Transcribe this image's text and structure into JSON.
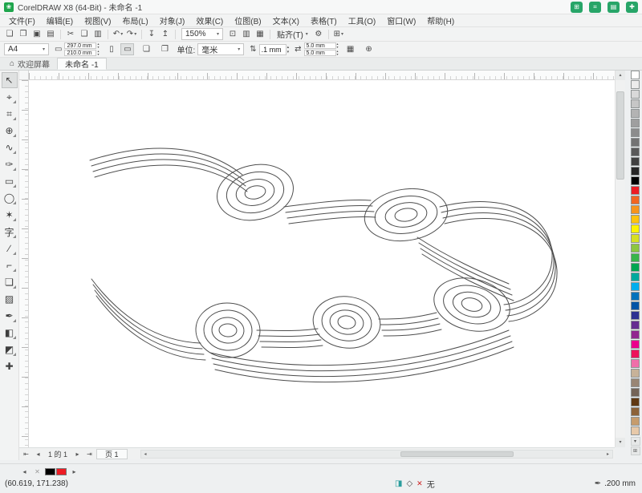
{
  "window": {
    "title": "CorelDRAW X8 (64-Bit) - 未命名 -1",
    "actions": [
      {
        "name": "action-1",
        "glyph": "⊞"
      },
      {
        "name": "action-2",
        "glyph": "⌗"
      },
      {
        "name": "action-3",
        "glyph": "▤"
      },
      {
        "name": "action-4",
        "glyph": "✚"
      }
    ]
  },
  "menu": {
    "items": [
      {
        "name": "file",
        "label": "文件(F)"
      },
      {
        "name": "edit",
        "label": "编辑(E)"
      },
      {
        "name": "view",
        "label": "视图(V)"
      },
      {
        "name": "layout",
        "label": "布局(L)"
      },
      {
        "name": "object",
        "label": "对象(J)"
      },
      {
        "name": "effects",
        "label": "效果(C)"
      },
      {
        "name": "bitmaps",
        "label": "位图(B)"
      },
      {
        "name": "text",
        "label": "文本(X)"
      },
      {
        "name": "table",
        "label": "表格(T)"
      },
      {
        "name": "tools",
        "label": "工具(O)"
      },
      {
        "name": "window",
        "label": "窗口(W)"
      },
      {
        "name": "help",
        "label": "帮助(H)"
      }
    ]
  },
  "toolbar": {
    "left": [
      {
        "name": "new-document",
        "glyph": "❏"
      },
      {
        "name": "open",
        "glyph": "❐"
      },
      {
        "name": "save",
        "glyph": "▣"
      },
      {
        "name": "print",
        "glyph": "▤"
      },
      {
        "sep": true
      },
      {
        "name": "cut",
        "glyph": "✂"
      },
      {
        "name": "copy",
        "glyph": "❑"
      },
      {
        "name": "paste",
        "glyph": "▥"
      },
      {
        "sep": true
      },
      {
        "name": "undo",
        "glyph": "↶",
        "dd": true
      },
      {
        "name": "redo",
        "glyph": "↷",
        "dd": true
      },
      {
        "sep": true
      },
      {
        "name": "import",
        "glyph": "↧"
      },
      {
        "name": "export",
        "glyph": "↥"
      },
      {
        "sep": true
      }
    ],
    "zoom_value": "150%",
    "mid": [
      {
        "name": "full-screen-preview",
        "glyph": "⊡"
      },
      {
        "name": "show-rulers",
        "glyph": "▥"
      },
      {
        "name": "show-grid",
        "glyph": "▦"
      },
      {
        "sep": true
      }
    ],
    "snap_label": "贴齐(T)",
    "end": [
      {
        "name": "options",
        "glyph": "⚙"
      },
      {
        "sep": true
      },
      {
        "name": "application-launcher",
        "glyph": "⊞",
        "dd": true
      }
    ]
  },
  "property_bar": {
    "page_size": "A4",
    "dims_icon": "▭",
    "width_value": "297.0 mm",
    "height_value": "210.0 mm",
    "portrait_glyph": "▯",
    "landscape_glyph": "▭",
    "pages": [
      {
        "name": "current-page-size",
        "glyph": "❏"
      },
      {
        "name": "all-pages-size",
        "glyph": "❐"
      }
    ],
    "units_label": "单位:",
    "units_value": "毫米",
    "nudge_icon": "⇅",
    "nudge_value": ".1 mm",
    "dup_icon": "⇄",
    "dup_x": "5.0 mm",
    "dup_y": "5.0 mm",
    "trailing": [
      {
        "name": "grid-toggle",
        "glyph": "▦"
      },
      {
        "name": "more-options",
        "glyph": "⊕"
      }
    ]
  },
  "tabs": {
    "welcome": "欢迎屏幕",
    "doc": "未命名 -1"
  },
  "toolbox": {
    "tools": [
      {
        "name": "pick",
        "glyph": "↖",
        "selected": true
      },
      {
        "name": "shape",
        "glyph": "⌖",
        "flyout": true
      },
      {
        "name": "crop",
        "glyph": "⌗",
        "flyout": true
      },
      {
        "name": "zoom",
        "glyph": "⊕",
        "flyout": true
      },
      {
        "name": "freehand",
        "glyph": "∿",
        "flyout": true
      },
      {
        "name": "artistic-media",
        "glyph": "✑",
        "flyout": true
      },
      {
        "name": "rectangle",
        "glyph": "▭",
        "flyout": true
      },
      {
        "name": "ellipse",
        "glyph": "◯",
        "flyout": true
      },
      {
        "name": "polygon",
        "glyph": "✶",
        "flyout": true
      },
      {
        "name": "text",
        "glyph": "字",
        "flyout": true
      },
      {
        "name": "parallel-dimension",
        "glyph": "∕",
        "flyout": true
      },
      {
        "name": "connector",
        "glyph": "⌐",
        "flyout": true
      },
      {
        "name": "drop-shadow",
        "glyph": "❏",
        "flyout": true
      },
      {
        "name": "transparency",
        "glyph": "▨"
      },
      {
        "name": "color-eyedropper",
        "glyph": "✒",
        "flyout": true
      },
      {
        "name": "interactive-fill",
        "glyph": "◧",
        "flyout": true
      },
      {
        "name": "smart-fill",
        "glyph": "◩",
        "flyout": true
      },
      {
        "name": "customize-toolbox",
        "glyph": "✚"
      }
    ]
  },
  "palette": {
    "colors": [
      "#FFFFFF",
      "#ECECEC",
      "#D9D9D9",
      "#C6C6C6",
      "#B3B3B3",
      "#9F9F9F",
      "#8C8C8C",
      "#737373",
      "#595959",
      "#404040",
      "#262626",
      "#000000",
      "#ED1C24",
      "#F26522",
      "#F7941D",
      "#FFC20E",
      "#FFF200",
      "#D7DF23",
      "#8DC63F",
      "#39B54A",
      "#00A651",
      "#00A99D",
      "#00AEEF",
      "#0072BC",
      "#0054A6",
      "#2E3192",
      "#662D91",
      "#92278F",
      "#EC008C",
      "#ED145B",
      "#F06EA9",
      "#C7B299",
      "#998675",
      "#736357",
      "#603913",
      "#8C6239",
      "#C69C6D",
      "#E7C9A9"
    ]
  },
  "pagebar": {
    "first_icon": "⇤",
    "prev_icon": "◂",
    "next_icon": "▸",
    "last_icon": "⇥",
    "counter": "1 的 1",
    "tab": "页 1"
  },
  "status": {
    "coords": "(60.619, 171.238)",
    "none_label": "无",
    "outline_value": ".200 mm",
    "doc_palette": [
      "#000000",
      "#ED1C24"
    ]
  },
  "ui_icons": {
    "logo": "❀",
    "dd": "▾",
    "spin_up": "▴",
    "spin_down": "▾",
    "scroll_left": "◂",
    "scroll_right": "▸",
    "scroll_up": "▴",
    "scroll_down": "▾",
    "palette_flyout": "⊞",
    "home": "⌂",
    "none_x": "✕",
    "fill_diamond": "◇",
    "outline_pen": "✒",
    "object_info": "◨"
  }
}
